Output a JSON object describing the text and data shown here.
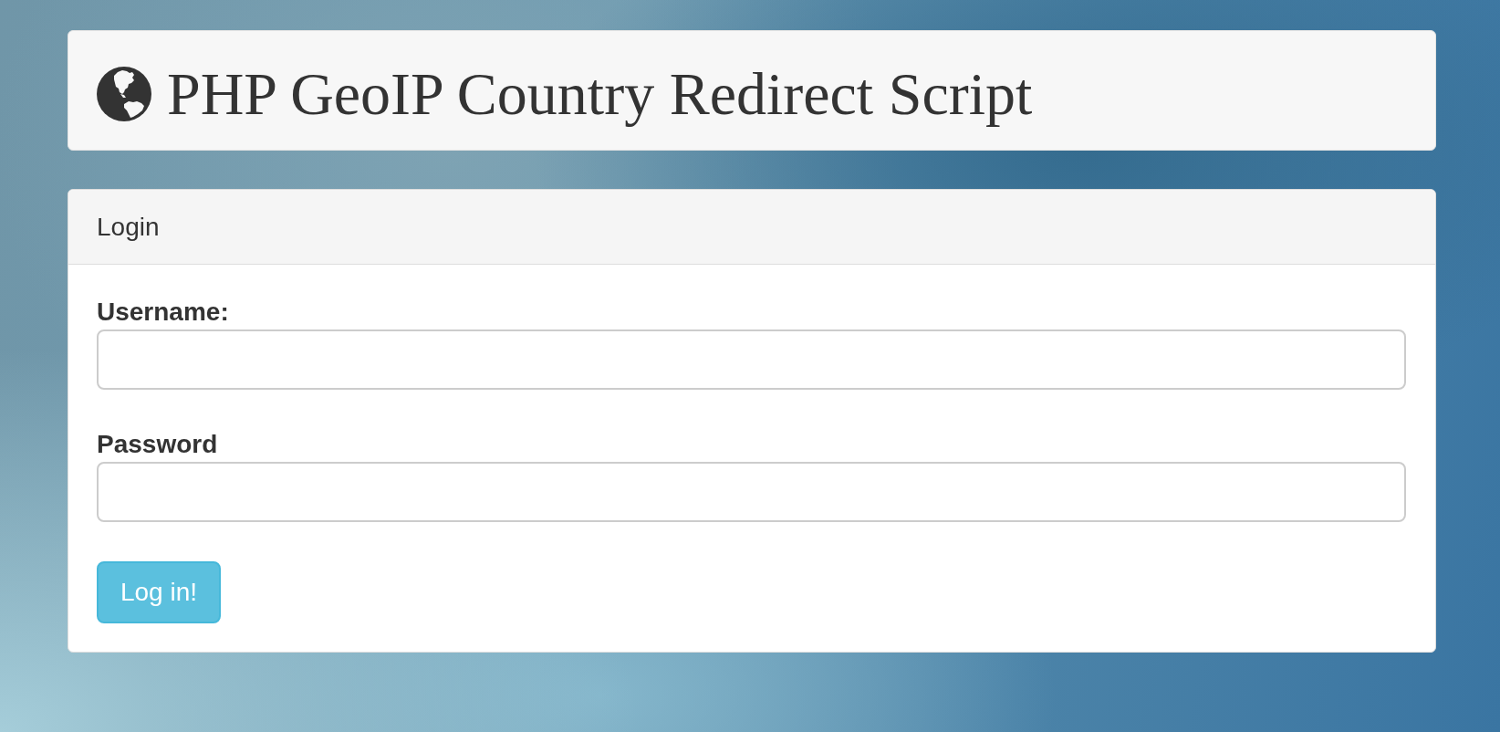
{
  "header": {
    "title": "PHP GeoIP Country Redirect Script"
  },
  "login_panel": {
    "heading": "Login",
    "fields": [
      {
        "label": "Username:"
      },
      {
        "label": "Password"
      }
    ],
    "submit_button": "Log in!"
  }
}
